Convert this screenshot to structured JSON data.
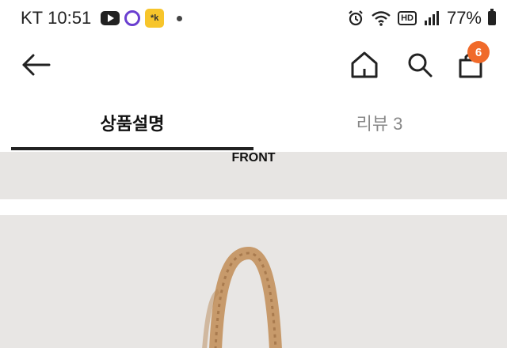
{
  "status_bar": {
    "carrier": "KT",
    "time": "10:51",
    "app_icon_text": "*k",
    "hd_label": "HD",
    "battery": "77%"
  },
  "header": {
    "cart_count": "6"
  },
  "tabs": [
    {
      "label": "상품설명",
      "active": true
    },
    {
      "label": "리뷰 3",
      "active": false
    }
  ],
  "content": {
    "front_label": "FRONT"
  },
  "colors": {
    "accent_badge": "#f06a2a",
    "panel_bg": "#e7e5e3",
    "bag_color": "#c79a6b"
  }
}
